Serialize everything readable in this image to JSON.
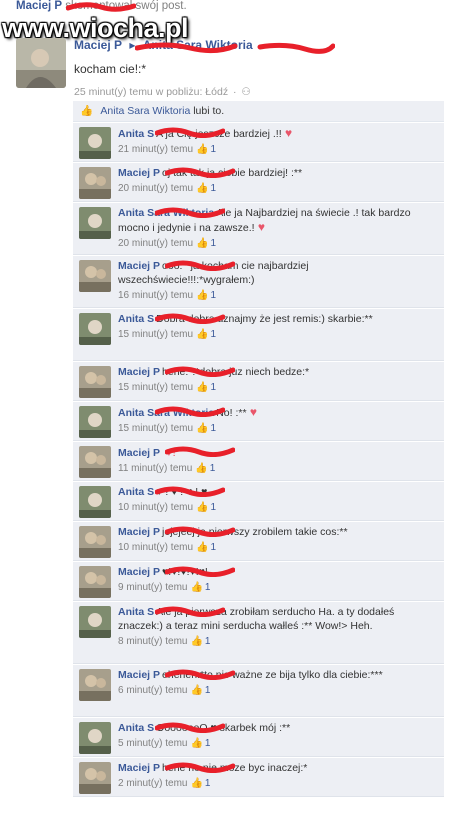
{
  "watermark": "www.wiocha.pl",
  "top_line": {
    "name": "Maciej P",
    "suffix": "skomentował swój post."
  },
  "post": {
    "author": "Maciej P",
    "target": "Anita Sara Wiktoria",
    "text": "kocham cie!:*",
    "time": "25 minut(y) temu w pobliżu: Łódź",
    "dot": "·"
  },
  "likes": {
    "name": "Anita Sara Wiktoria",
    "suffix": "lubi to."
  },
  "comments": [
    {
      "author": "Anita S",
      "text": "A ja Cię jeszcze bardziej .!!",
      "heart_suffix": "♥",
      "time": "21 minut(y) temu",
      "likes": "1"
    },
    {
      "author": "Maciej P",
      "text": "oj tak tak ja ciebie bardziej! :**",
      "heart_suffix": "",
      "time": "20 minut(y) temu",
      "likes": "1"
    },
    {
      "author": "Anita Sara Wiktoria",
      "text": "Ale ja Najbardziej na świecie .! tak bardzo mocno i jedynie i na zawsze.!",
      "heart_suffix": "♥",
      "time": "20 minut(y) temu",
      "likes": "1"
    },
    {
      "author": "Maciej P",
      "text": "ooo:**ja kocham cie najbardziej wszechświecie!!!:*wygrałem:)",
      "heart_suffix": "",
      "time": "16 minut(y) temu",
      "likes": "1"
    },
    {
      "author": "Anita S",
      "text": "Dobra dobra uznajmy że jest remis:) skarbie:**",
      "heart_suffix": "",
      "time": "15 minut(y) temu",
      "likes": "1"
    },
    {
      "author": "Maciej P",
      "text": "hehe:*:*dobra juz niech bedze:*",
      "heart_suffix": "",
      "time": "15 minut(y) temu",
      "likes": "1"
    },
    {
      "author": "Anita Sara Wiktoria",
      "text": "No! :**",
      "heart_suffix": "♥",
      "time": "15 minut(y) temu",
      "likes": "1"
    },
    {
      "author": "Maciej P",
      "text": "",
      "heart_suffix": "♥!",
      "time": "11 minut(y) temu",
      "likes": "1"
    },
    {
      "author": "Anita S",
      "text": "♥ ! ♥ ! ♥ ! ♥",
      "heart_suffix": "",
      "time": "10 minut(y) temu",
      "likes": "1"
    },
    {
      "author": "Maciej P",
      "text": "jejejeej ja pierwszy zrobilem takie cos:**",
      "heart_suffix": "",
      "time": "10 minut(y) temu",
      "likes": "1"
    },
    {
      "author": "Maciej P",
      "text": "♥!♥!♥!♥!♥!",
      "heart_suffix": "",
      "time": "9 minut(y) temu",
      "likes": "1"
    },
    {
      "author": "Anita S",
      "text": "Ale ja pierwsza zrobiłam serducho Ha. a ty dodałeś znaczek:) a teraz mini serducha wałleś :** Wow!> Heh.",
      "heart_suffix": "",
      "time": "8 minut(y) temu",
      "likes": "1"
    },
    {
      "author": "Maciej P",
      "text": "eheheh:*to nic ważne ze bija tylko dla ciebie:***",
      "heart_suffix": "",
      "time": "6 minut(y) temu",
      "likes": "1"
    },
    {
      "author": "Anita S",
      "text": "OooooooO ♥ skarbek mój :**",
      "heart_suffix": "",
      "time": "5 minut(y) temu",
      "likes": "1"
    },
    {
      "author": "Maciej P",
      "text": "hehe no nie moze byc inaczej:*",
      "heart_suffix": "",
      "time": "2 minut(y) temu",
      "likes": "1"
    }
  ]
}
